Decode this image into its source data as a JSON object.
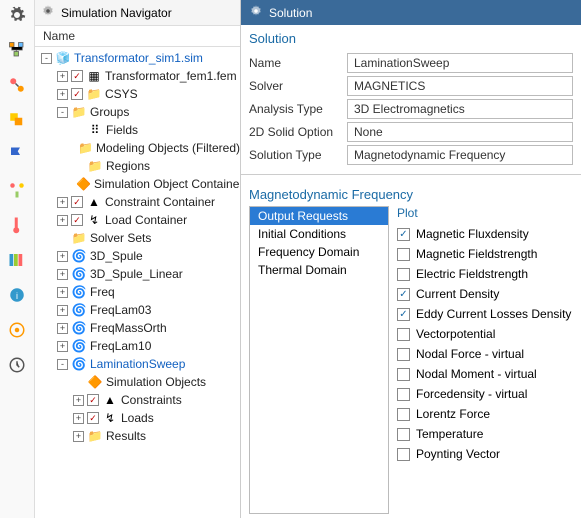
{
  "nav": {
    "title": "Simulation Navigator",
    "col": "Name",
    "tree": [
      {
        "d": 0,
        "tw": "-",
        "chk": null,
        "icon": "sim",
        "label": "Transformator_sim1.sim",
        "blue": true
      },
      {
        "d": 1,
        "tw": "+",
        "chk": true,
        "icon": "fem",
        "label": "Transformator_fem1.fem"
      },
      {
        "d": 1,
        "tw": "+",
        "chk": true,
        "icon": "folder",
        "label": "CSYS"
      },
      {
        "d": 1,
        "tw": "-",
        "chk": null,
        "icon": "folder",
        "label": "Groups"
      },
      {
        "d": 2,
        "tw": " ",
        "chk": null,
        "icon": "fields",
        "label": "Fields"
      },
      {
        "d": 2,
        "tw": " ",
        "chk": null,
        "icon": "folder",
        "label": "Modeling Objects (Filtered)"
      },
      {
        "d": 2,
        "tw": " ",
        "chk": null,
        "icon": "folder",
        "label": "Regions"
      },
      {
        "d": 2,
        "tw": " ",
        "chk": null,
        "icon": "simobj",
        "label": "Simulation Object Container"
      },
      {
        "d": 1,
        "tw": "+",
        "chk": true,
        "icon": "constraint",
        "label": "Constraint Container"
      },
      {
        "d": 1,
        "tw": "+",
        "chk": true,
        "icon": "load",
        "label": "Load Container"
      },
      {
        "d": 1,
        "tw": " ",
        "chk": null,
        "icon": "folder",
        "label": "Solver Sets"
      },
      {
        "d": 1,
        "tw": "+",
        "chk": null,
        "icon": "sol",
        "label": "3D_Spule"
      },
      {
        "d": 1,
        "tw": "+",
        "chk": null,
        "icon": "sol",
        "label": "3D_Spule_Linear"
      },
      {
        "d": 1,
        "tw": "+",
        "chk": null,
        "icon": "sol",
        "label": "Freq"
      },
      {
        "d": 1,
        "tw": "+",
        "chk": null,
        "icon": "sol",
        "label": "FreqLam03"
      },
      {
        "d": 1,
        "tw": "+",
        "chk": null,
        "icon": "sol",
        "label": "FreqMassOrth"
      },
      {
        "d": 1,
        "tw": "+",
        "chk": null,
        "icon": "sol",
        "label": "FreqLam10"
      },
      {
        "d": 1,
        "tw": "-",
        "chk": null,
        "icon": "sol",
        "label": "LaminationSweep",
        "blue": true
      },
      {
        "d": 2,
        "tw": " ",
        "chk": null,
        "icon": "simobj",
        "label": "Simulation Objects"
      },
      {
        "d": 2,
        "tw": "+",
        "chk": true,
        "icon": "constraint",
        "label": "Constraints"
      },
      {
        "d": 2,
        "tw": "+",
        "chk": true,
        "icon": "load",
        "label": "Loads"
      },
      {
        "d": 2,
        "tw": "+",
        "chk": null,
        "icon": "folder",
        "label": "Results"
      }
    ]
  },
  "solution": {
    "header": "Solution",
    "section": "Solution",
    "name_label": "Name",
    "name": "LaminationSweep",
    "solver_label": "Solver",
    "solver": "MAGNETICS",
    "analysis_label": "Analysis Type",
    "analysis": "3D Electromagnetics",
    "twod_label": "2D Solid Option",
    "twod": "None",
    "soltype_label": "Solution Type",
    "soltype": "Magnetodynamic Frequency",
    "section2": "Magnetodynamic Frequency",
    "list": [
      "Output Requests",
      "Initial Conditions",
      "Frequency Domain",
      "Thermal Domain"
    ],
    "list_selected": 0,
    "plot_title": "Plot",
    "plot_options": [
      {
        "label": "Magnetic Fluxdensity",
        "on": true
      },
      {
        "label": "Magnetic Fieldstrength",
        "on": false
      },
      {
        "label": "Electric Fieldstrength",
        "on": false
      },
      {
        "label": "Current Density",
        "on": true
      },
      {
        "label": "Eddy Current Losses Density",
        "on": true
      },
      {
        "label": "Vectorpotential",
        "on": false
      },
      {
        "label": "Nodal Force - virtual",
        "on": false
      },
      {
        "label": "Nodal Moment - virtual",
        "on": false
      },
      {
        "label": "Forcedensity - virtual",
        "on": false
      },
      {
        "label": "Lorentz Force",
        "on": false
      },
      {
        "label": "Temperature",
        "on": false
      },
      {
        "label": "Poynting Vector",
        "on": false
      }
    ]
  },
  "icons": {
    "sim": "🧊",
    "fem": "▦",
    "folder": "📁",
    "fields": "⠿",
    "simobj": "🔶",
    "constraint": "▲",
    "load": "↯",
    "sol": "🌀"
  }
}
